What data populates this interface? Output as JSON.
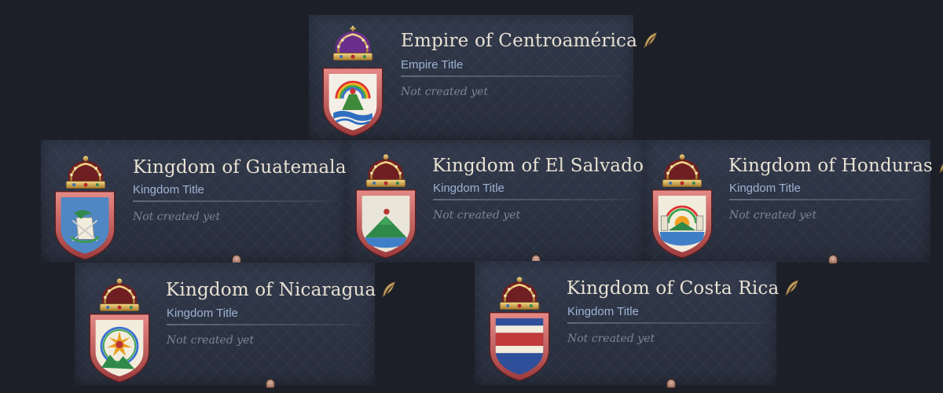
{
  "titles": [
    {
      "name": "Empire of Centroamérica",
      "type": "Empire Title",
      "status": "Not created yet",
      "crown": "imperial-crown-icon",
      "coa": "centroamerica-coat-of-arms"
    },
    {
      "name": "Kingdom of Guatemala",
      "type": "Kingdom Title",
      "status": "Not created yet",
      "crown": "royal-crown-icon",
      "coa": "guatemala-coat-of-arms"
    },
    {
      "name": "Kingdom of El Salvador",
      "type": "Kingdom Title",
      "status": "Not created yet",
      "crown": "royal-crown-icon",
      "coa": "el-salvador-coat-of-arms"
    },
    {
      "name": "Kingdom of Honduras",
      "type": "Kingdom Title",
      "status": "Not created yet",
      "crown": "royal-crown-icon",
      "coa": "honduras-coat-of-arms"
    },
    {
      "name": "Kingdom of Nicaragua",
      "type": "Kingdom Title",
      "status": "Not created yet",
      "crown": "royal-crown-icon",
      "coa": "nicaragua-coat-of-arms"
    },
    {
      "name": "Kingdom of Costa Rica",
      "type": "Kingdom Title",
      "status": "Not created yet",
      "crown": "royal-crown-icon",
      "coa": "costa-rica-coat-of-arms"
    }
  ],
  "colors": {
    "background": "#1d1f28",
    "card": "#2a3141",
    "title_text": "#e8e1d3",
    "subtitle_text": "#9fb3d3",
    "status_text": "#7d8496",
    "shield_border": "#c65c5c",
    "quill": "#c8a66a"
  }
}
